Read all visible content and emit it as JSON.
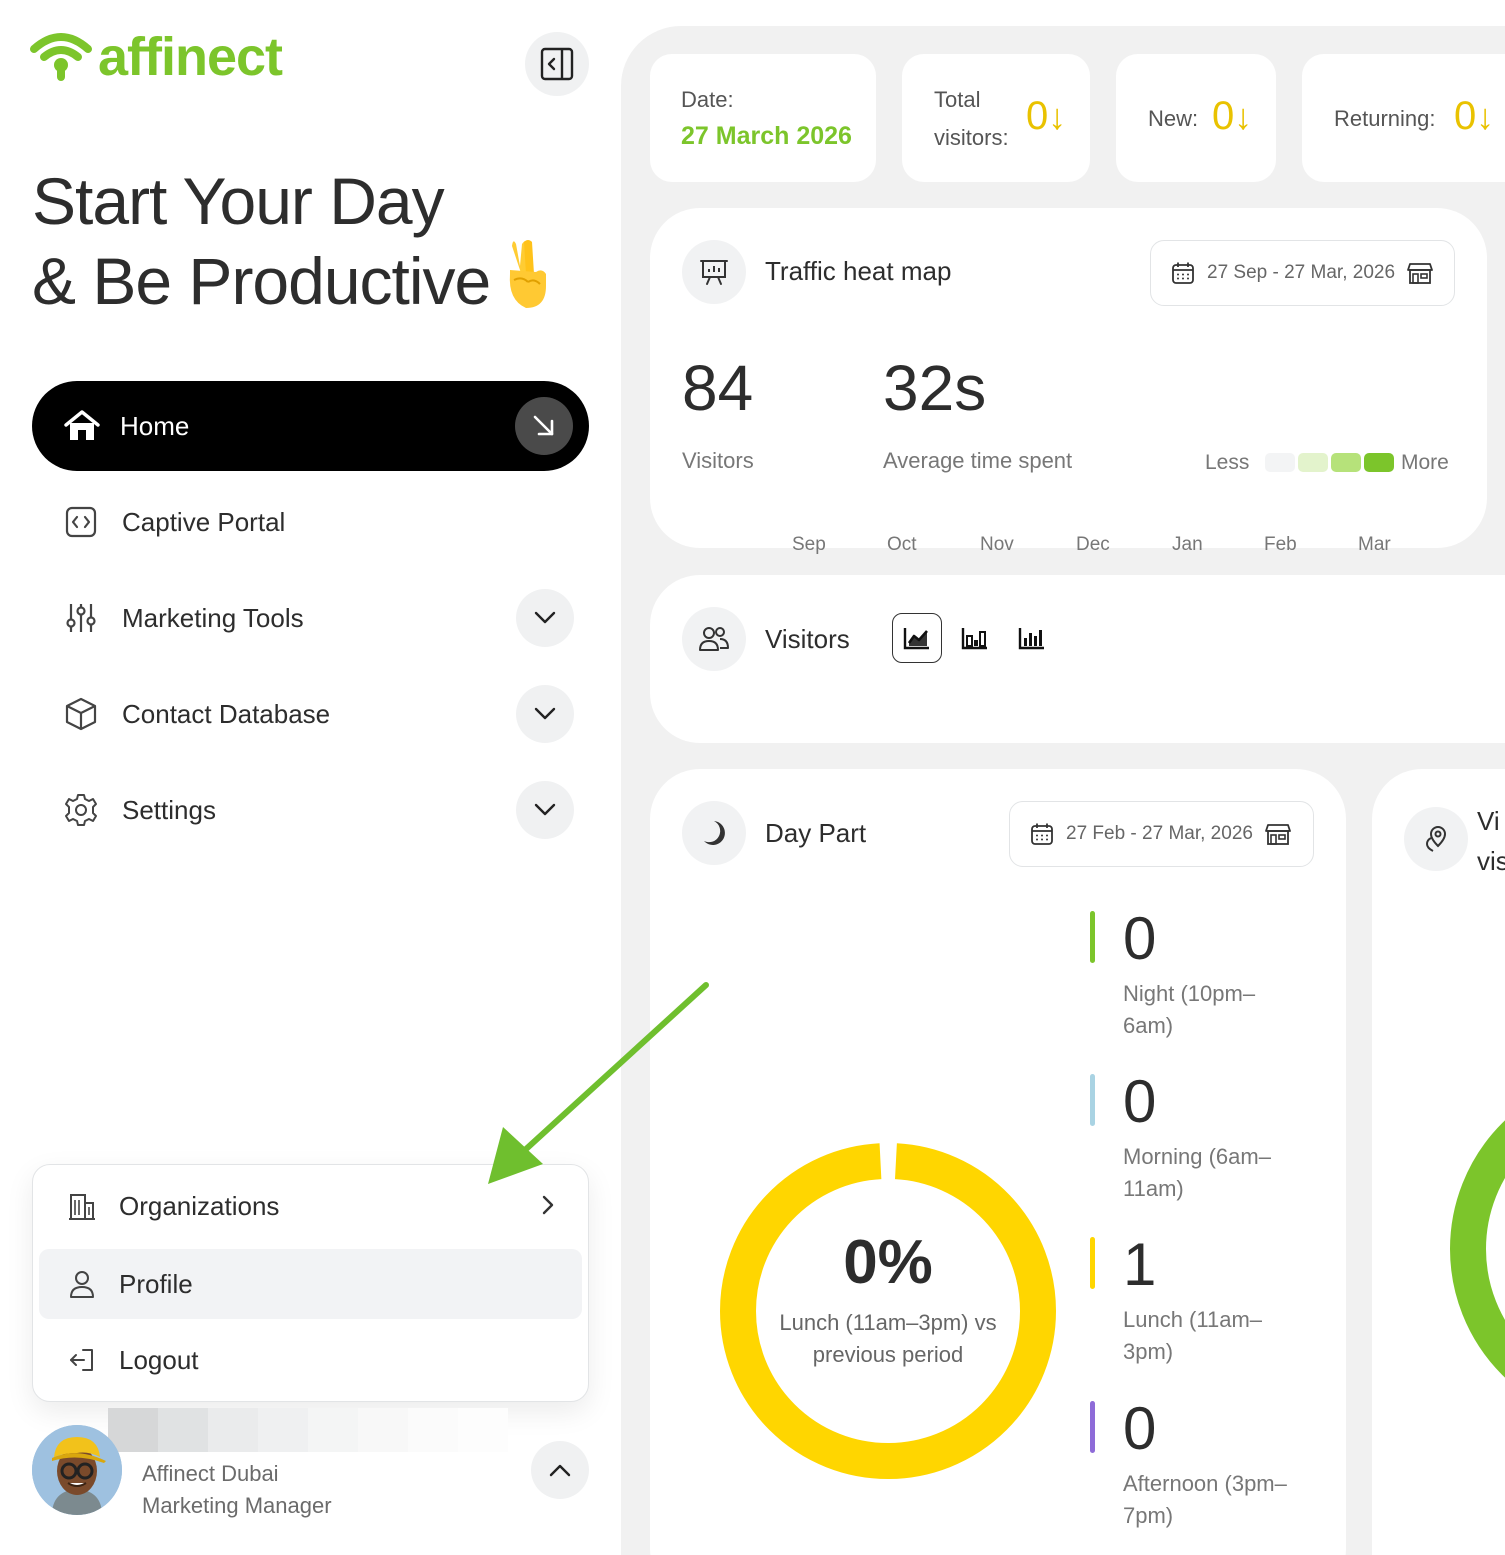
{
  "brand": {
    "name": "affinect",
    "color": "#7cc52b"
  },
  "greeting": {
    "line1": "Start Your Day",
    "line2": "& Be Productive"
  },
  "nav": {
    "home": "Home",
    "captive_portal": "Captive Portal",
    "marketing_tools": "Marketing Tools",
    "contact_database": "Contact Database",
    "settings": "Settings"
  },
  "account_menu": {
    "organizations": "Organizations",
    "profile": "Profile",
    "logout": "Logout"
  },
  "user": {
    "name": "Affinect Dubai",
    "role": "Marketing Manager"
  },
  "stats": {
    "date_label": "Date:",
    "date_value": "27 March 2026",
    "total_label_1": "Total",
    "total_label_2": "visitors:",
    "total_value": "0",
    "new_label": "New:",
    "new_value": "0",
    "returning_label": "Returning:",
    "returning_value": "0",
    "trend_arrow": "↓"
  },
  "traffic_heat_map": {
    "title": "Traffic heat map",
    "date_range": "27 Sep - 27 Mar, 2026",
    "visitors_value": "84",
    "visitors_label": "Visitors",
    "avg_time_value": "32s",
    "avg_time_label": "Average time spent",
    "legend_less": "Less",
    "legend_more": "More",
    "legend_colors": [
      "#f3f4f5",
      "#e3f3cc",
      "#b6e27a",
      "#7cc52b"
    ],
    "months": [
      "Sep",
      "Oct",
      "Nov",
      "Dec",
      "Jan",
      "Feb",
      "Mar"
    ]
  },
  "visitors_card": {
    "title": "Visitors"
  },
  "day_part": {
    "title": "Day Part",
    "date_range": "27 Feb - 27 Mar, 2026",
    "donut_percent": "0%",
    "donut_caption_1": "Lunch (11am–3pm) vs",
    "donut_caption_2": "previous period",
    "donut_color": "#ffd600",
    "items": [
      {
        "value": "0",
        "label_1": "Night (10pm–",
        "label_2": "6am)",
        "color": "#7cc52b"
      },
      {
        "value": "0",
        "label_1": "Morning (6am–",
        "label_2": "11am)",
        "color": "#a9d3e3"
      },
      {
        "value": "1",
        "label_1": "Lunch (11am–",
        "label_2": "3pm)",
        "color": "#ffd600"
      },
      {
        "value": "0",
        "label_1": "Afternoon (3pm–",
        "label_2": "7pm)",
        "color": "#8e6bd8"
      }
    ]
  },
  "partial_card": {
    "title_1": "Vi",
    "title_2": "vis",
    "ring_color": "#7cc52b"
  },
  "annotation": {
    "arrow_color": "#6fbf2e"
  }
}
